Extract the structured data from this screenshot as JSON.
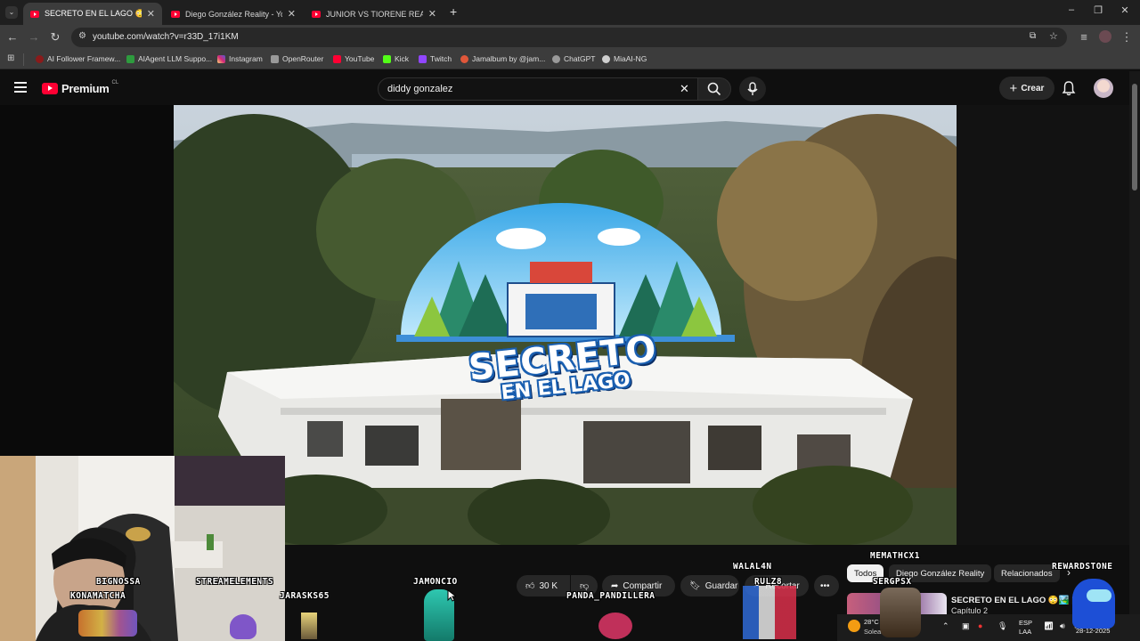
{
  "browser": {
    "tabs": [
      {
        "label": "SECRETO EN EL LAGO 😳🏞️ | C",
        "active": true
      },
      {
        "label": "Diego González Reality - YouTu",
        "active": false
      },
      {
        "label": "JUNIOR VS TIORENE REALITY D",
        "active": false
      }
    ],
    "new_tab": "+",
    "url": "youtube.com/watch?v=r33D_17i1KM",
    "bookmarks": [
      {
        "label": "AI Follower Framew...",
        "color": "#8b1a1a"
      },
      {
        "label": "AIAgent LLM Suppo...",
        "color": "#2e9b3e"
      },
      {
        "label": "Instagram",
        "color": "#d6249f"
      },
      {
        "label": "OpenRouter",
        "color": "#9a9a9a"
      },
      {
        "label": "YouTube",
        "color": "#ff0033"
      },
      {
        "label": "Kick",
        "color": "#53fc18"
      },
      {
        "label": "Twitch",
        "color": "#9146ff"
      },
      {
        "label": "Jamalbum by @jam...",
        "color": "#e0573a"
      },
      {
        "label": "ChatGPT",
        "color": "#9a9a9a"
      },
      {
        "label": "MiaAI-NG",
        "color": "#cfcfcf"
      }
    ]
  },
  "youtube": {
    "logo_text": "Premium",
    "region": "CL",
    "search_value": "diddy gonzalez",
    "create_label": "Crear"
  },
  "video": {
    "title_line1": "SECRETO",
    "title_line2": "EN EL LAGO"
  },
  "actions": {
    "likes": "30 K",
    "share": "Compartir",
    "save": "Guardar",
    "remix": "Recortar"
  },
  "chips": [
    "Todos",
    "Diego González Reality",
    "Relacionados"
  ],
  "recommended": {
    "title": "SECRETO EN EL LAGO 😳🏞️ |",
    "subtitle": "Capítulo 2"
  },
  "overlay_names": [
    "MEMATHCX1",
    "REWARDSTONE",
    "WALAL4N",
    "RULZ8",
    "SERGPSX",
    "BIGNOSSA",
    "STREAMELEMENTS",
    "KONAMATCHA",
    "JARASKS65",
    "JAMONCIO",
    "PANDA_PANDILLERA"
  ],
  "taskbar": {
    "weather_temp": "28°C",
    "weather_label": "Soleado",
    "lang1": "ESP",
    "lang2": "LAA",
    "date": "28-12-2025"
  }
}
